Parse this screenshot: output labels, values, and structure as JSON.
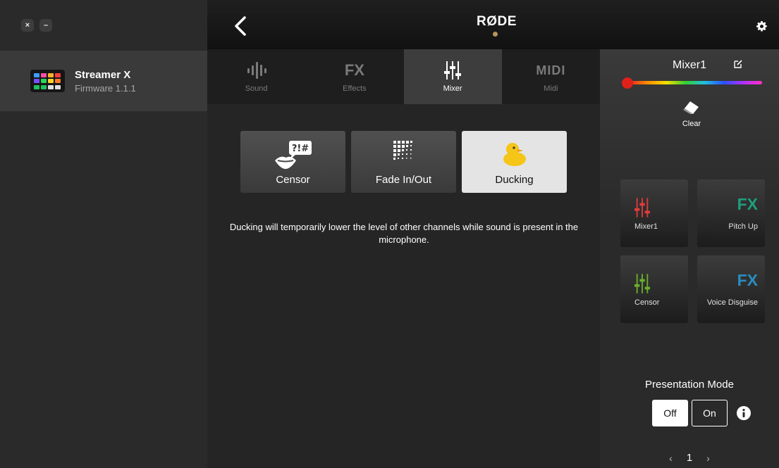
{
  "window": {
    "close_label": "×",
    "minimize_label": "–"
  },
  "device": {
    "name": "Streamer X",
    "firmware": "Firmware 1.1.1"
  },
  "header": {
    "logo": "RØDE"
  },
  "tabs": [
    {
      "label": "Sound",
      "icon": "sound-wave-icon"
    },
    {
      "label": "Effects",
      "icon_text": "FX"
    },
    {
      "label": "Mixer",
      "icon": "mixer-sliders-icon",
      "active": true
    },
    {
      "label": "Midi",
      "icon_text": "MIDI"
    }
  ],
  "effects": [
    {
      "label": "Censor",
      "icon": "censor-lips-icon",
      "bubble_text": "?!#"
    },
    {
      "label": "Fade In/Out",
      "icon": "fade-dots-icon"
    },
    {
      "label": "Ducking",
      "icon": "duck-icon",
      "selected": true
    }
  ],
  "description": "Ducking will temporarily lower the level of other channels while sound is present in the microphone.",
  "panel": {
    "title": "Mixer1",
    "clear_label": "Clear",
    "pads": [
      {
        "label": "Mixer1",
        "icon": "mixer-sliders-icon",
        "color": "#e23b3b"
      },
      {
        "label": "Pitch Up",
        "icon_text": "FX",
        "color": "#1f9e7a"
      },
      {
        "label": "Censor",
        "icon": "mixer-sliders-icon",
        "color": "#6ab02c"
      },
      {
        "label": "Voice Disguise",
        "icon_text": "FX",
        "color": "#2a8cc0"
      }
    ],
    "presentation_mode": {
      "title": "Presentation Mode",
      "off_label": "Off",
      "on_label": "On",
      "selected": "Off"
    },
    "page": "1",
    "prev": "‹",
    "next": "›"
  }
}
